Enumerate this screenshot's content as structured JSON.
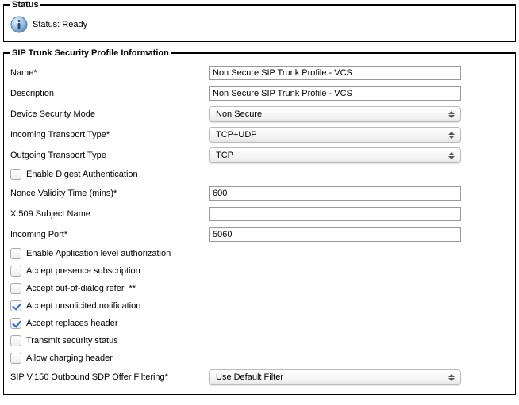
{
  "status": {
    "legend": "Status",
    "text": "Status: Ready"
  },
  "info": {
    "legend": "SIP Trunk Security Profile Information",
    "fields": {
      "name_label": "Name",
      "name_value": "Non Secure SIP Trunk Profile - VCS",
      "desc_label": "Description",
      "desc_value": "Non Secure SIP Trunk Profile - VCS",
      "sec_mode_label": "Device Security Mode",
      "sec_mode_value": "Non Secure",
      "in_trans_label": "Incoming Transport Type",
      "in_trans_value": "TCP+UDP",
      "out_trans_label": "Outgoing Transport Type",
      "out_trans_value": "TCP",
      "enable_digest_label": "Enable Digest Authentication",
      "nonce_label": "Nonce Validity Time (mins)",
      "nonce_value": "600",
      "x509_label": "X.509 Subject Name",
      "x509_value": "",
      "inport_label": "Incoming Port",
      "inport_value": "5060",
      "app_auth_label": "Enable Application level authorization",
      "presence_label": "Accept presence subscription",
      "ood_refer_label": "Accept out-of-dialog refer",
      "unsolicited_label": "Accept unsolicited notification",
      "replaces_label": "Accept replaces header",
      "transmit_sec_label": "Transmit security status",
      "charging_label": "Allow charging header",
      "sdp_filter_label": "SIP V.150 Outbound SDP Offer Filtering",
      "sdp_filter_value": "Use Default Filter"
    },
    "checks": {
      "enable_digest": false,
      "app_auth": false,
      "presence": false,
      "ood_refer": false,
      "unsolicited": true,
      "replaces": true,
      "transmit_sec": false,
      "charging": false
    }
  }
}
